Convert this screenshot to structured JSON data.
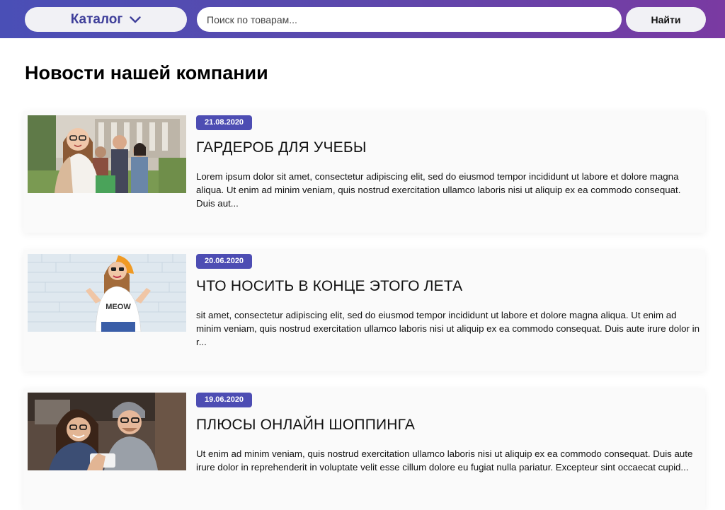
{
  "header": {
    "catalog_label": "Каталог",
    "search_placeholder": "Поиск по товарам...",
    "search_button": "Найти"
  },
  "page_title": "Новости нашей компании",
  "news": [
    {
      "date": "21.08.2020",
      "title": "ГАРДЕРОБ ДЛЯ УЧЕБЫ",
      "excerpt": "Lorem ipsum dolor sit amet, consectetur adipiscing elit, sed do eiusmod tempor incididunt ut labore et dolore magna aliqua. Ut enim ad minim veniam, quis nostrud exercitation ullamco laboris nisi ut aliquip ex ea commodo consequat. Duis aut...",
      "image": "students-photo"
    },
    {
      "date": "20.06.2020",
      "title": "ЧТО НОСИТЬ В КОНЦЕ ЭТОГО ЛЕТА",
      "excerpt": "sit amet, consectetur adipiscing elit, sed do eiusmod tempor incididunt ut labore et dolore magna aliqua. Ut enim ad minim veniam, quis nostrud exercitation ullamco laboris nisi ut aliquip ex ea commodo consequat. Duis aute irure dolor in r...",
      "image": "summer-girl-photo",
      "image_text": "MEOW"
    },
    {
      "date": "19.06.2020",
      "title": "ПЛЮСЫ ОНЛАЙН ШОППИНГА",
      "excerpt": "Ut enim ad minim veniam, quis nostrud exercitation ullamco laboris nisi ut aliquip ex ea commodo consequat. Duis aute irure dolor in reprehenderit in voluptate velit esse cillum dolore eu fugiat nulla pariatur. Excepteur sint occaecat cupid...",
      "image": "couple-phone-photo"
    }
  ],
  "colors": {
    "header_gradient_start": "#4a4fb6",
    "header_gradient_end": "#7a3aa2",
    "accent": "#4d4db3",
    "catalog_text": "#3f3f9a"
  }
}
